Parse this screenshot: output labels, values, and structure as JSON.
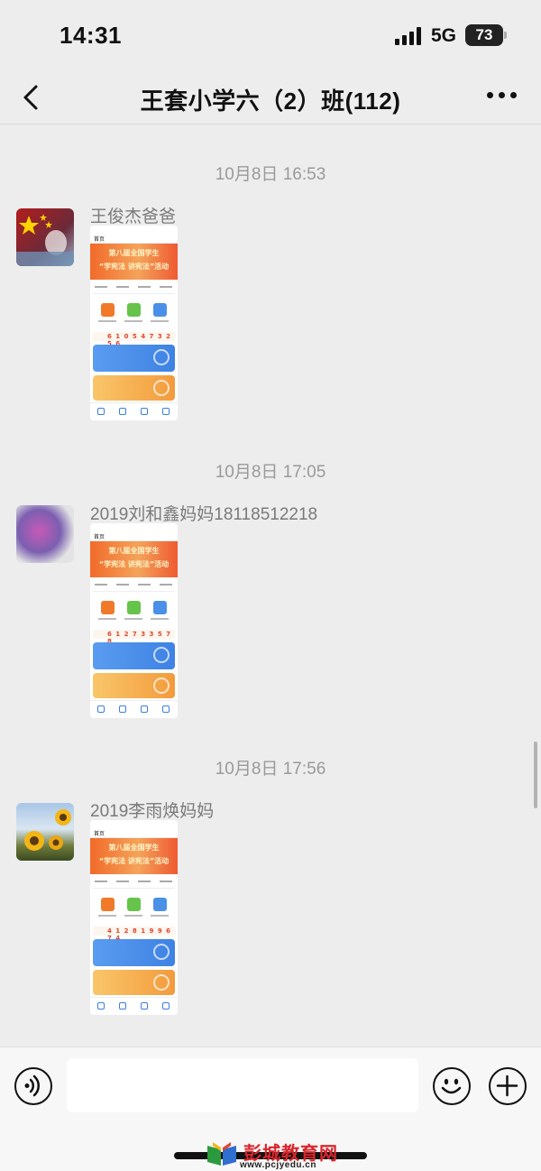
{
  "status": {
    "time": "14:31",
    "network": "5G",
    "battery": "73"
  },
  "nav": {
    "title": "王套小学六（2）班(112)"
  },
  "messages": [
    {
      "timestamp": "10月8日 16:53",
      "sender": "王俊杰爸爸",
      "shot_numbers": "6 1 0 5 4 7 3 2 5 6"
    },
    {
      "timestamp": "10月8日 17:05",
      "sender": "2019刘和鑫妈妈18118512218",
      "shot_numbers": "6 1 2 7 3 3 5 7 8"
    },
    {
      "timestamp": "10月8日 17:56",
      "sender": "2019李雨焕妈妈",
      "shot_numbers": "4 1 2 8 1 9 9 6 7 4"
    }
  ],
  "shot": {
    "home": "首页",
    "banner_line1": "第八届全国学生",
    "banner_line2": "“学宪法 讲宪法”活动"
  },
  "input": {
    "placeholder": ""
  },
  "watermark": {
    "name": "彭城教育网",
    "url": "www.pcjyedu.cn"
  },
  "colors": {
    "background": "#ededed",
    "banner": "#f26a2a",
    "blue_card": "#3e82e4",
    "orange_card": "#f39b3c",
    "watermark": "#d8262c"
  }
}
